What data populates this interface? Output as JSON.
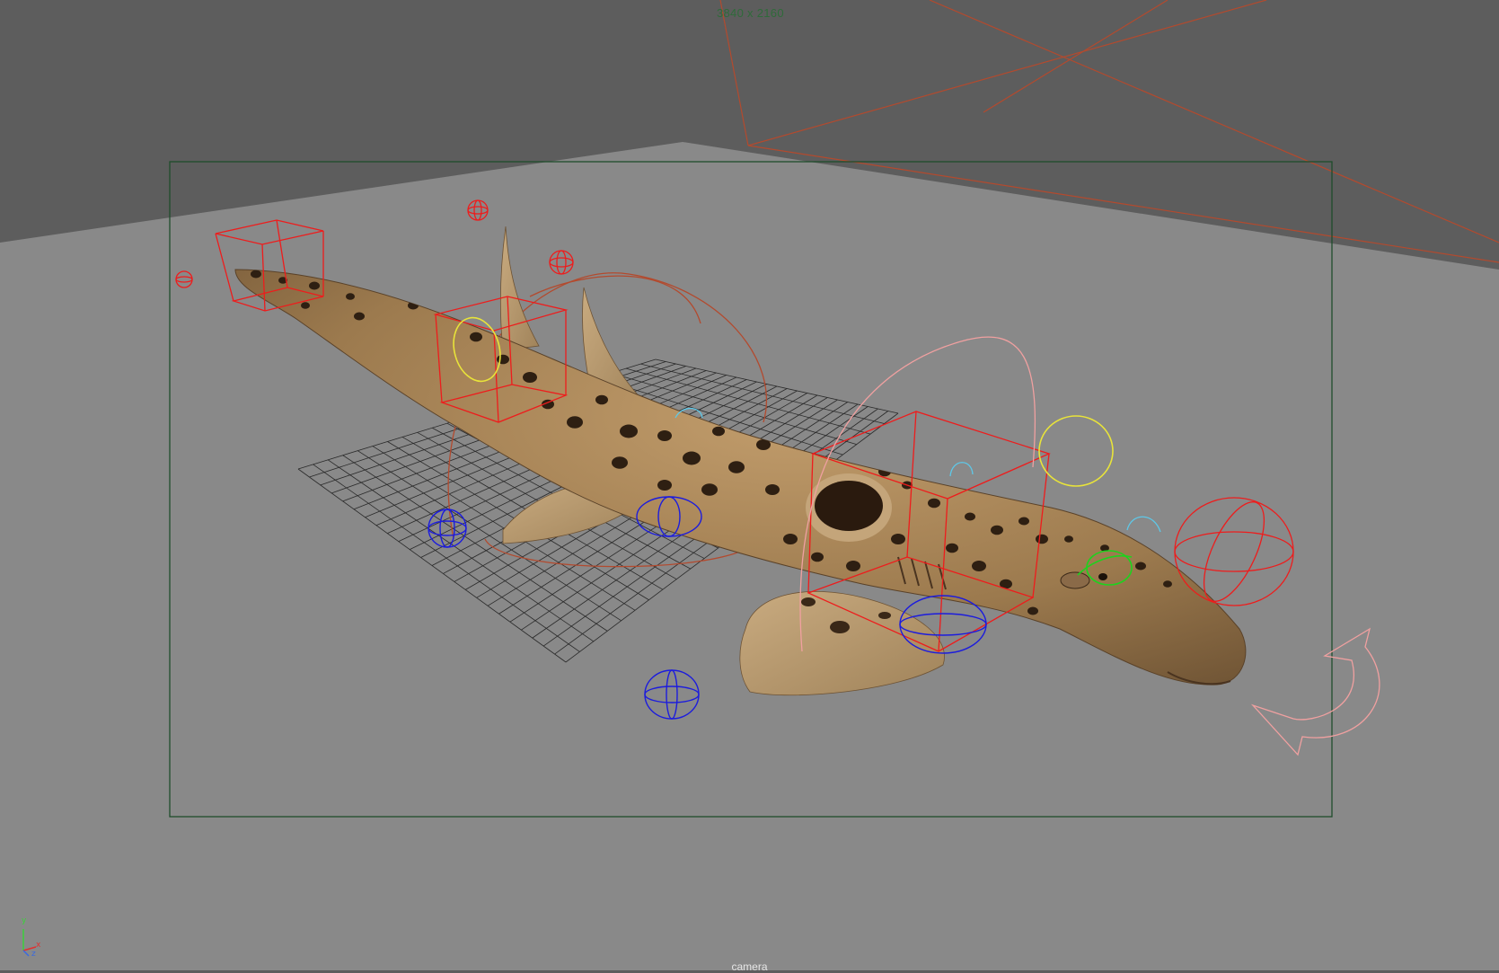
{
  "viewport": {
    "resolution_gate_label": "3840 x 2160",
    "camera_name": "camera",
    "axis_labels": {
      "y": "y",
      "x": "x",
      "z": "z"
    }
  },
  "colors": {
    "floor_dark": "#5d5d5d",
    "floor_light": "#898989",
    "grid_line": "#2a2a2a",
    "resolution_gate": "#1e4d2b",
    "camera_frustum": "#b34a2e",
    "rig_fk_control": "#ee1c1c",
    "rig_ik_control": "#1c1cdd",
    "rig_ctrl_yellow": "#e8e33a",
    "rig_ctrl_green": "#1ed21e",
    "rig_ctrl_cyan": "#5ec8e8",
    "rig_ctrl_pink": "#f0a0a0",
    "shark_skin": "#a6855a",
    "shark_belly": "#c8a97c",
    "shark_spot": "#2e1f12"
  },
  "scene": {
    "model": "shark-icon",
    "controls": [
      "box-control-icon",
      "sphere-control-icon",
      "circle-control-icon",
      "curve-control-icon",
      "rotate-arrow-icon"
    ]
  }
}
